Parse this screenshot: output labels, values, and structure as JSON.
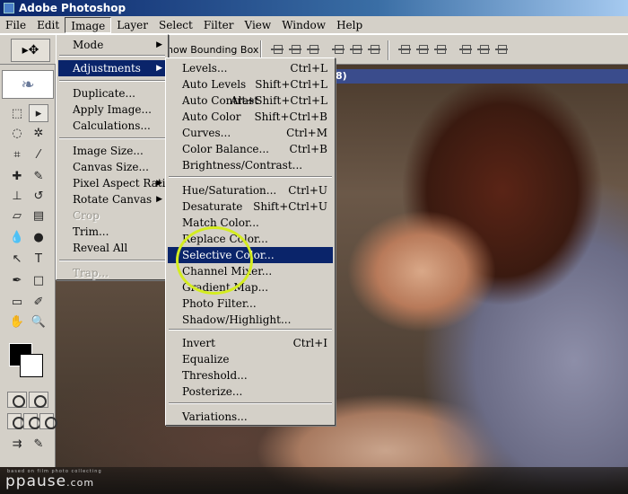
{
  "app": {
    "title": "Adobe Photoshop"
  },
  "menubar": {
    "items": [
      {
        "label": "File",
        "active": false
      },
      {
        "label": "Edit",
        "active": false
      },
      {
        "label": "Image",
        "active": true
      },
      {
        "label": "Layer",
        "active": false
      },
      {
        "label": "Select",
        "active": false
      },
      {
        "label": "Filter",
        "active": false
      },
      {
        "label": "View",
        "active": false
      },
      {
        "label": "Window",
        "active": false
      },
      {
        "label": "Help",
        "active": false
      }
    ]
  },
  "optionsbar": {
    "bounding_box_label": "how Bounding Box",
    "tool_glyph": "▸✥"
  },
  "document": {
    "titlebar_fragment": "8)"
  },
  "image_menu": {
    "items": [
      {
        "label": "Mode",
        "submenu": true,
        "disabled": false,
        "highlight": false
      },
      {
        "label": "Adjustments",
        "submenu": true,
        "disabled": false,
        "highlight": true
      },
      {
        "label": "Duplicate...",
        "submenu": false,
        "disabled": false,
        "highlight": false
      },
      {
        "label": "Apply Image...",
        "submenu": false,
        "disabled": false,
        "highlight": false
      },
      {
        "label": "Calculations...",
        "submenu": false,
        "disabled": false,
        "highlight": false
      },
      {
        "label": "Image Size...",
        "submenu": false,
        "disabled": false,
        "highlight": false
      },
      {
        "label": "Canvas Size...",
        "submenu": false,
        "disabled": false,
        "highlight": false
      },
      {
        "label": "Pixel Aspect Ratio",
        "submenu": true,
        "disabled": false,
        "highlight": false
      },
      {
        "label": "Rotate Canvas",
        "submenu": true,
        "disabled": false,
        "highlight": false
      },
      {
        "label": "Crop",
        "submenu": false,
        "disabled": true,
        "highlight": false
      },
      {
        "label": "Trim...",
        "submenu": false,
        "disabled": false,
        "highlight": false
      },
      {
        "label": "Reveal All",
        "submenu": false,
        "disabled": false,
        "highlight": false
      },
      {
        "label": "Trap...",
        "submenu": false,
        "disabled": true,
        "highlight": false
      }
    ]
  },
  "adjustments_menu": {
    "items": [
      {
        "label": "Levels...",
        "shortcut": "Ctrl+L",
        "highlight": false
      },
      {
        "label": "Auto Levels",
        "shortcut": "Shift+Ctrl+L",
        "highlight": false
      },
      {
        "label": "Auto Contrast",
        "shortcut": "Alt+Shift+Ctrl+L",
        "highlight": false
      },
      {
        "label": "Auto Color",
        "shortcut": "Shift+Ctrl+B",
        "highlight": false
      },
      {
        "label": "Curves...",
        "shortcut": "Ctrl+M",
        "highlight": false
      },
      {
        "label": "Color Balance...",
        "shortcut": "Ctrl+B",
        "highlight": false
      },
      {
        "label": "Brightness/Contrast...",
        "shortcut": "",
        "highlight": false
      },
      {
        "label": "Hue/Saturation...",
        "shortcut": "Ctrl+U",
        "highlight": false
      },
      {
        "label": "Desaturate",
        "shortcut": "Shift+Ctrl+U",
        "highlight": false
      },
      {
        "label": "Match Color...",
        "shortcut": "",
        "highlight": false
      },
      {
        "label": "Replace Color...",
        "shortcut": "",
        "highlight": false
      },
      {
        "label": "Selective Color...",
        "shortcut": "",
        "highlight": true
      },
      {
        "label": "Channel Mixer...",
        "shortcut": "",
        "highlight": false
      },
      {
        "label": "Gradient Map...",
        "shortcut": "",
        "highlight": false
      },
      {
        "label": "Photo Filter...",
        "shortcut": "",
        "highlight": false
      },
      {
        "label": "Shadow/Highlight...",
        "shortcut": "",
        "highlight": false
      },
      {
        "label": "Invert",
        "shortcut": "Ctrl+I",
        "highlight": false
      },
      {
        "label": "Equalize",
        "shortcut": "",
        "highlight": false
      },
      {
        "label": "Threshold...",
        "shortcut": "",
        "highlight": false
      },
      {
        "label": "Posterize...",
        "shortcut": "",
        "highlight": false
      },
      {
        "label": "Variations...",
        "shortcut": "",
        "highlight": false
      }
    ]
  },
  "toolbox": {
    "tools": [
      {
        "name": "marquee-tool-icon",
        "glyph": "⬚",
        "selected": false
      },
      {
        "name": "move-tool-icon",
        "glyph": "▸",
        "selected": true
      },
      {
        "name": "lasso-tool-icon",
        "glyph": "◌",
        "selected": false
      },
      {
        "name": "magic-wand-icon",
        "glyph": "✲",
        "selected": false
      },
      {
        "name": "crop-tool-icon",
        "glyph": "⌗",
        "selected": false
      },
      {
        "name": "slice-tool-icon",
        "glyph": "⁄",
        "selected": false
      },
      {
        "name": "healing-brush-icon",
        "glyph": "✚",
        "selected": false
      },
      {
        "name": "brush-tool-icon",
        "glyph": "✎",
        "selected": false
      },
      {
        "name": "clone-stamp-icon",
        "glyph": "⊥",
        "selected": false
      },
      {
        "name": "history-brush-icon",
        "glyph": "↺",
        "selected": false
      },
      {
        "name": "eraser-tool-icon",
        "glyph": "▱",
        "selected": false
      },
      {
        "name": "gradient-tool-icon",
        "glyph": "▤",
        "selected": false
      },
      {
        "name": "blur-tool-icon",
        "glyph": "💧",
        "selected": false
      },
      {
        "name": "dodge-tool-icon",
        "glyph": "●",
        "selected": false
      },
      {
        "name": "path-select-icon",
        "glyph": "↖",
        "selected": false
      },
      {
        "name": "type-tool-icon",
        "glyph": "T",
        "selected": false
      },
      {
        "name": "pen-tool-icon",
        "glyph": "✒",
        "selected": false
      },
      {
        "name": "shape-tool-icon",
        "glyph": "□",
        "selected": false
      },
      {
        "name": "notes-tool-icon",
        "glyph": "▭",
        "selected": false
      },
      {
        "name": "eyedropper-icon",
        "glyph": "✐",
        "selected": false
      },
      {
        "name": "hand-tool-icon",
        "glyph": "✋",
        "selected": false
      },
      {
        "name": "zoom-tool-icon",
        "glyph": "🔍",
        "selected": false
      }
    ],
    "foreground_color": "#000000",
    "background_color": "#ffffff"
  },
  "footer": {
    "brand": "ppause",
    "brand_suffix": ".com",
    "tagline": "based on film photo collecting"
  },
  "colors": {
    "menu_highlight": "#0a246a",
    "menu_bg": "#d4d0c8",
    "circle_accent": "#d4ec20"
  }
}
